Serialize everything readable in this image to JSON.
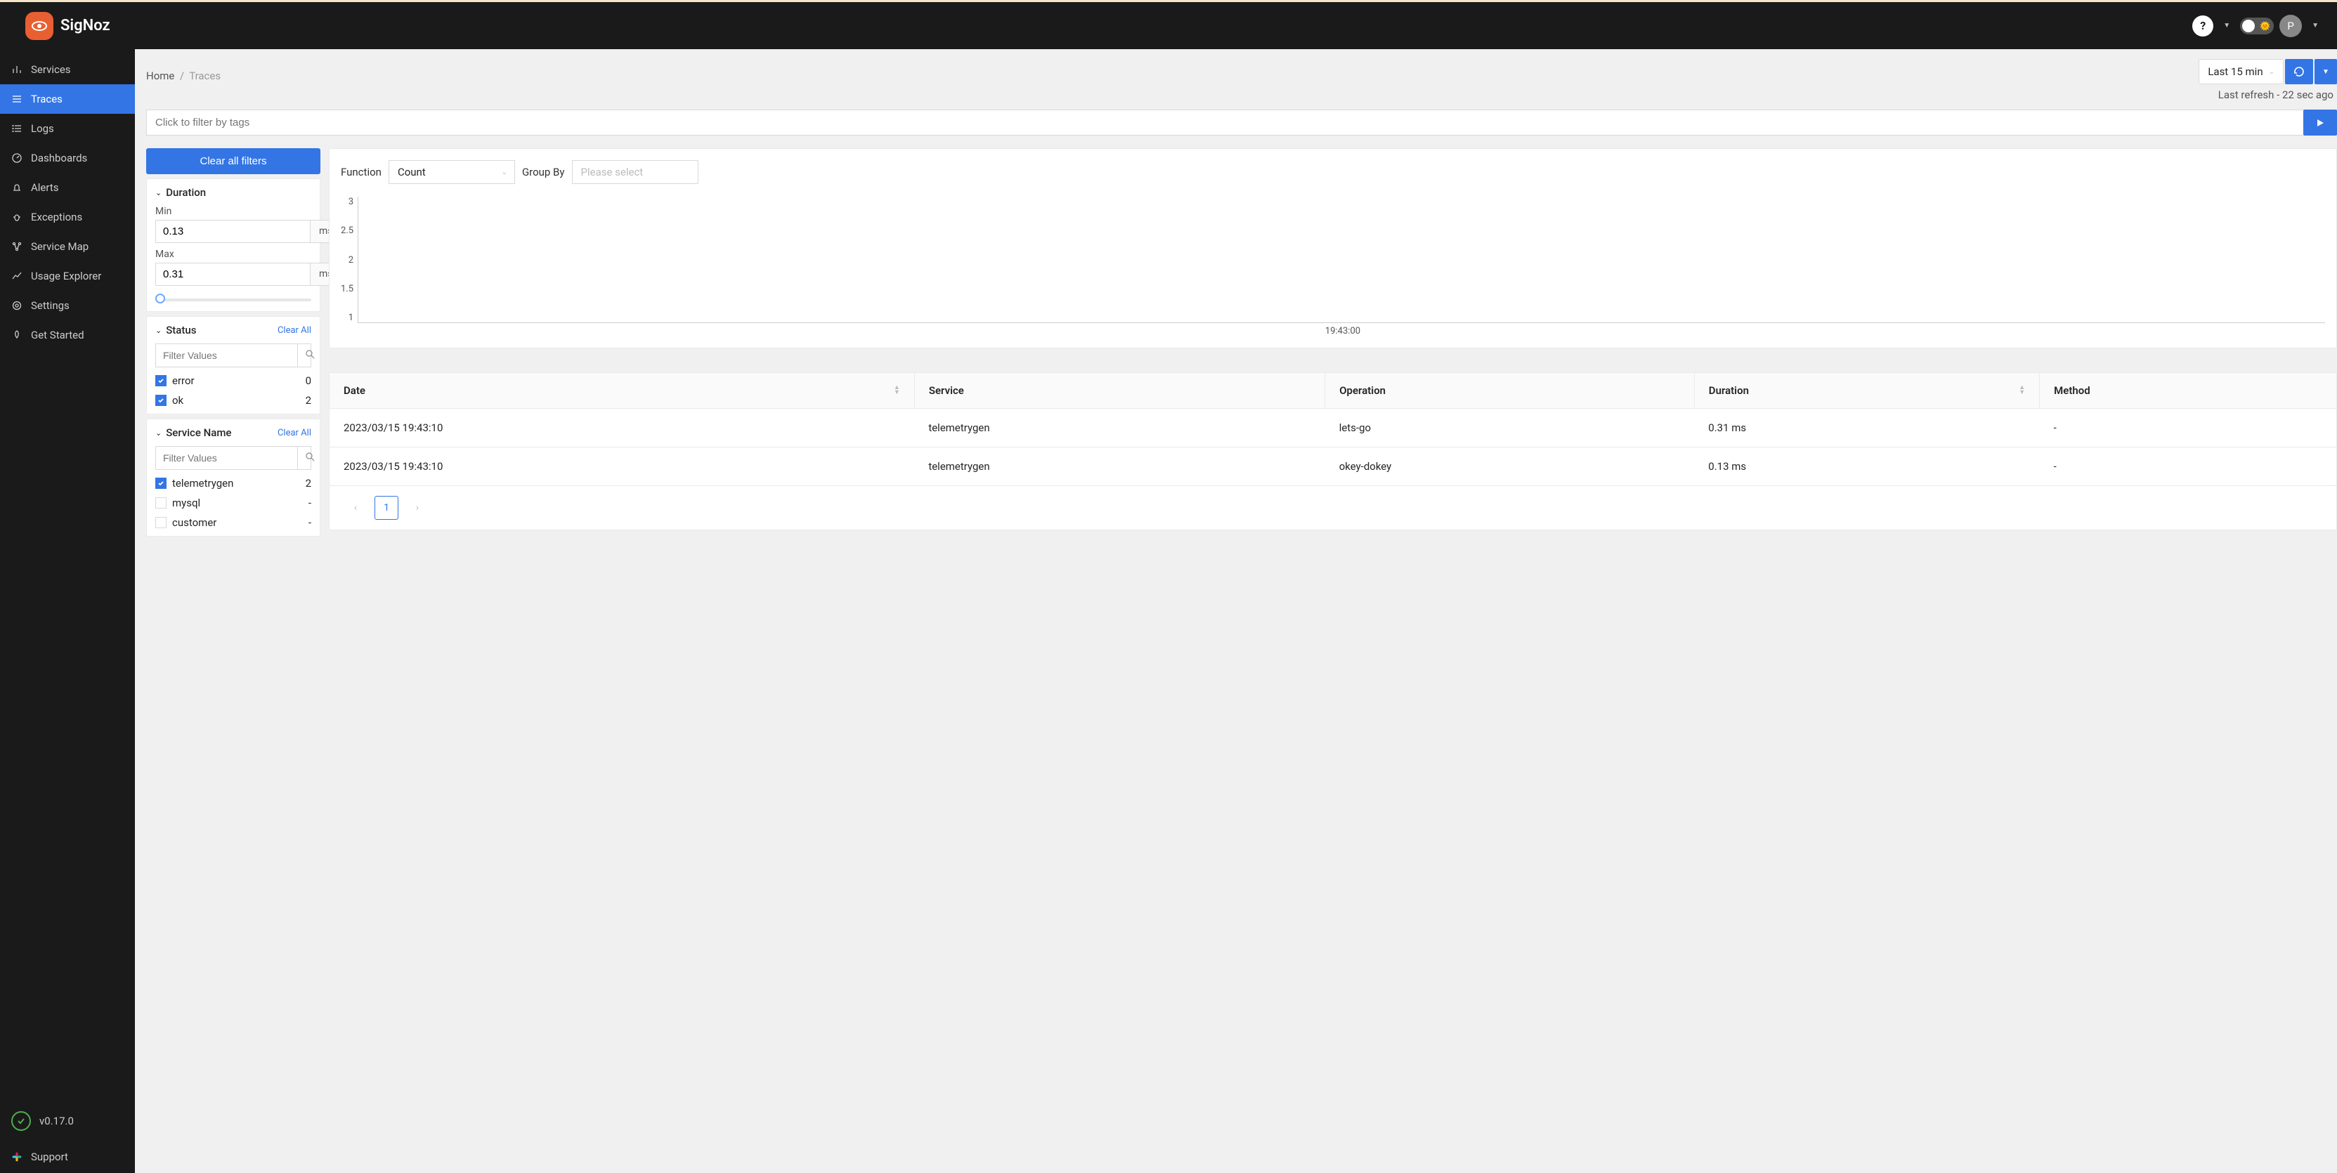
{
  "brand": "SigNoz",
  "topbar": {
    "help_glyph": "?",
    "avatar_initial": "P"
  },
  "sidebar": {
    "items": [
      {
        "label": "Services",
        "active": false
      },
      {
        "label": "Traces",
        "active": true
      },
      {
        "label": "Logs",
        "active": false
      },
      {
        "label": "Dashboards",
        "active": false
      },
      {
        "label": "Alerts",
        "active": false
      },
      {
        "label": "Exceptions",
        "active": false
      },
      {
        "label": "Service Map",
        "active": false
      },
      {
        "label": "Usage Explorer",
        "active": false
      },
      {
        "label": "Settings",
        "active": false
      },
      {
        "label": "Get Started",
        "active": false
      }
    ],
    "version": "v0.17.0",
    "support": "Support"
  },
  "breadcrumb": {
    "home": "Home",
    "sep": "/",
    "current": "Traces"
  },
  "time": {
    "range": "Last 15 min",
    "refresh": "Last refresh - 22 sec ago"
  },
  "search": {
    "placeholder": "Click to filter by tags"
  },
  "filters": {
    "clear_all_btn": "Clear all filters",
    "clear_link": "Clear All",
    "search_placeholder": "Filter Values",
    "duration": {
      "title": "Duration",
      "min_label": "Min",
      "min_value": "0.13",
      "max_label": "Max",
      "max_value": "0.31",
      "unit": "ms"
    },
    "status": {
      "title": "Status",
      "items": [
        {
          "label": "error",
          "count": "0",
          "checked": true
        },
        {
          "label": "ok",
          "count": "2",
          "checked": true
        }
      ]
    },
    "service": {
      "title": "Service Name",
      "items": [
        {
          "label": "telemetrygen",
          "count": "2",
          "checked": true
        },
        {
          "label": "mysql",
          "count": "-",
          "checked": false
        },
        {
          "label": "customer",
          "count": "-",
          "checked": false
        }
      ]
    }
  },
  "fn": {
    "function_label": "Function",
    "function_value": "Count",
    "groupby_label": "Group By",
    "groupby_placeholder": "Please select"
  },
  "chart_data": {
    "type": "line",
    "ylim": [
      1,
      3
    ],
    "y_ticks": [
      "3",
      "2.5",
      "2",
      "1.5",
      "1"
    ],
    "x_tick": "19:43:00",
    "series": []
  },
  "table": {
    "columns": [
      "Date",
      "Service",
      "Operation",
      "Duration",
      "Method"
    ],
    "rows": [
      {
        "date": "2023/03/15 19:43:10",
        "service": "telemetrygen",
        "operation": "lets-go",
        "duration": "0.31 ms",
        "method": "-"
      },
      {
        "date": "2023/03/15 19:43:10",
        "service": "telemetrygen",
        "operation": "okey-dokey",
        "duration": "0.13 ms",
        "method": "-"
      }
    ],
    "page": "1"
  }
}
